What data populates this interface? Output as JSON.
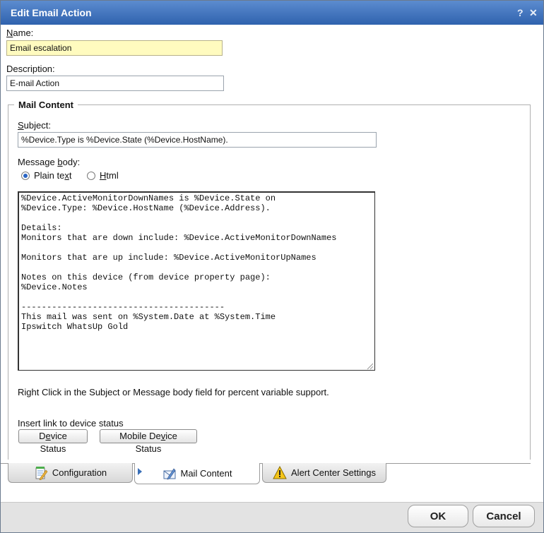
{
  "dialog": {
    "title": "Edit Email Action",
    "help_label": "?",
    "close_label": "✕"
  },
  "name": {
    "label_first": "N",
    "label_rest": "ame:",
    "value": "Email escalation"
  },
  "description": {
    "label_pre": "Description",
    "label_post": ":",
    "value": "E-mail Action"
  },
  "mail_content": {
    "legend": "Mail Content",
    "subject": {
      "label_first": "S",
      "label_rest": "ubject:",
      "value": "%Device.Type is %Device.State (%Device.HostName)."
    },
    "message_body": {
      "label_pre": "Message ",
      "label_accent": "b",
      "label_post": "ody:",
      "format_options": [
        {
          "pre": "Plain te",
          "accent": "x",
          "post": "t",
          "selected": true
        },
        {
          "pre": "",
          "accent": "H",
          "post": "tml",
          "selected": false
        }
      ],
      "text": "%Device.ActiveMonitorDownNames is %Device.State on\n%Device.Type: %Device.HostName (%Device.Address).\n\nDetails:\nMonitors that are down include: %Device.ActiveMonitorDownNames\n\nMonitors that are up include: %Device.ActiveMonitorUpNames\n\nNotes on this device (from device property page):\n%Device.Notes\n\n----------------------------------------\nThis mail was sent on %System.Date at %System.Time\nIpswitch WhatsUp Gold"
    },
    "hint": "Right Click in the Subject or Message body field for percent variable support.",
    "insert_link_label": "Insert link to device status",
    "device_status_button": {
      "pre": "D",
      "accent": "e",
      "post": "vice Status"
    },
    "mobile_device_status_button": {
      "pre": "Mobile De",
      "accent": "v",
      "post": "ice Status"
    }
  },
  "tabs": [
    {
      "label": "Configuration",
      "icon": "notepad-pencil-icon",
      "active": false
    },
    {
      "label": "Mail Content",
      "icon": "envelope-pencil-icon",
      "active": true
    },
    {
      "label": "Alert Center Settings",
      "icon": "warning-triangle-icon",
      "active": false
    }
  ],
  "footer": {
    "ok_label": "OK",
    "cancel_label": "Cancel"
  },
  "colors": {
    "title_bar": "#2f62ae",
    "name_field_bg": "#fffbbf",
    "footer_bg": "#e3e3e3"
  }
}
